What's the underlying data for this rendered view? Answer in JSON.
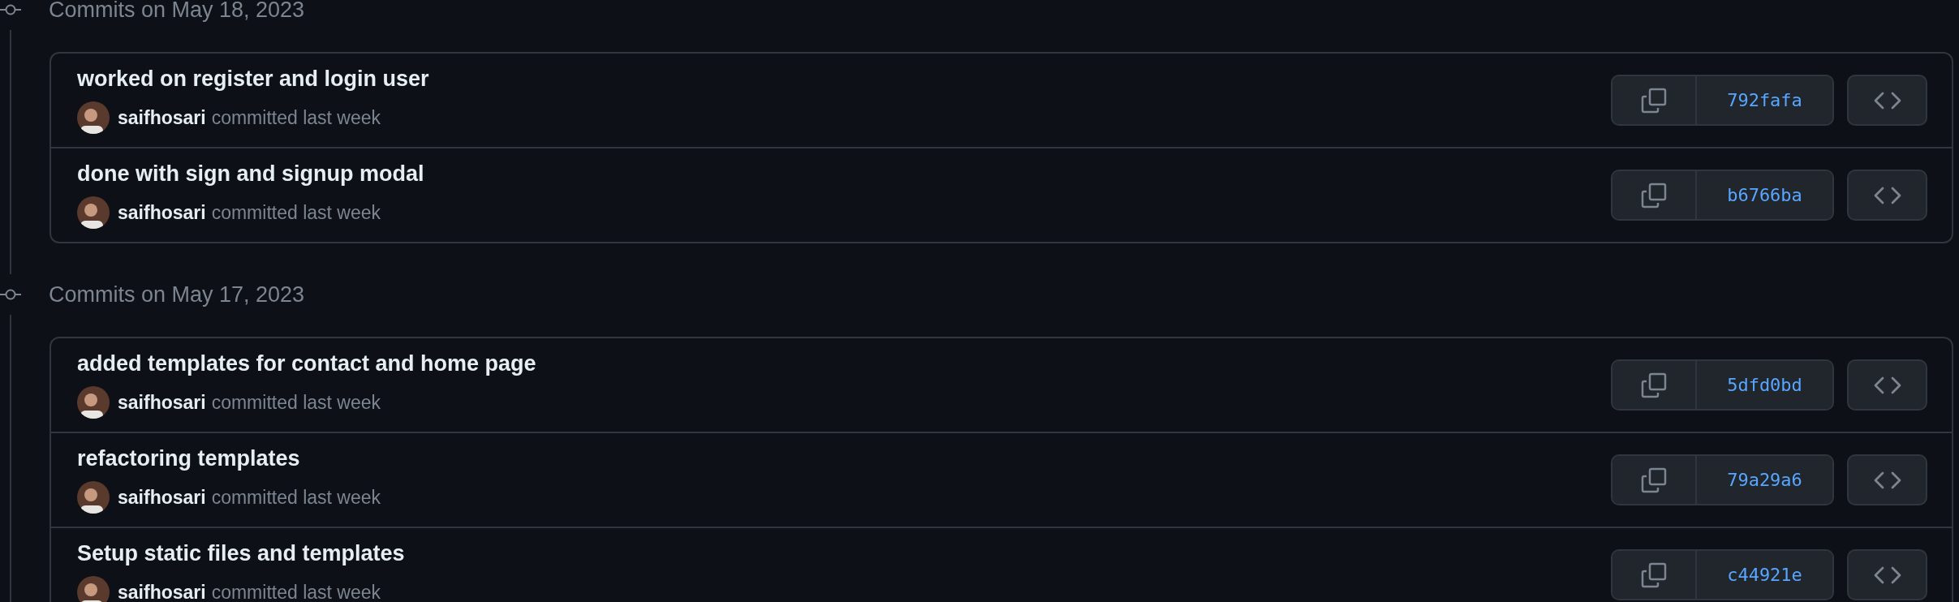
{
  "groups": [
    {
      "title": "Commits on May 18, 2023",
      "commits": [
        {
          "message": "worked on register and login user",
          "author": "saifhosari",
          "time_text": "committed last week",
          "sha": "792fafa"
        },
        {
          "message": "done with sign and signup modal",
          "author": "saifhosari",
          "time_text": "committed last week",
          "sha": "b6766ba"
        }
      ]
    },
    {
      "title": "Commits on May 17, 2023",
      "commits": [
        {
          "message": "added templates for contact and home page",
          "author": "saifhosari",
          "time_text": "committed last week",
          "sha": "5dfd0bd"
        },
        {
          "message": "refactoring templates",
          "author": "saifhosari",
          "time_text": "committed last week",
          "sha": "79a29a6"
        },
        {
          "message": "Setup static files and templates",
          "author": "saifhosari",
          "time_text": "committed last week",
          "sha": "c44921e"
        }
      ]
    }
  ]
}
